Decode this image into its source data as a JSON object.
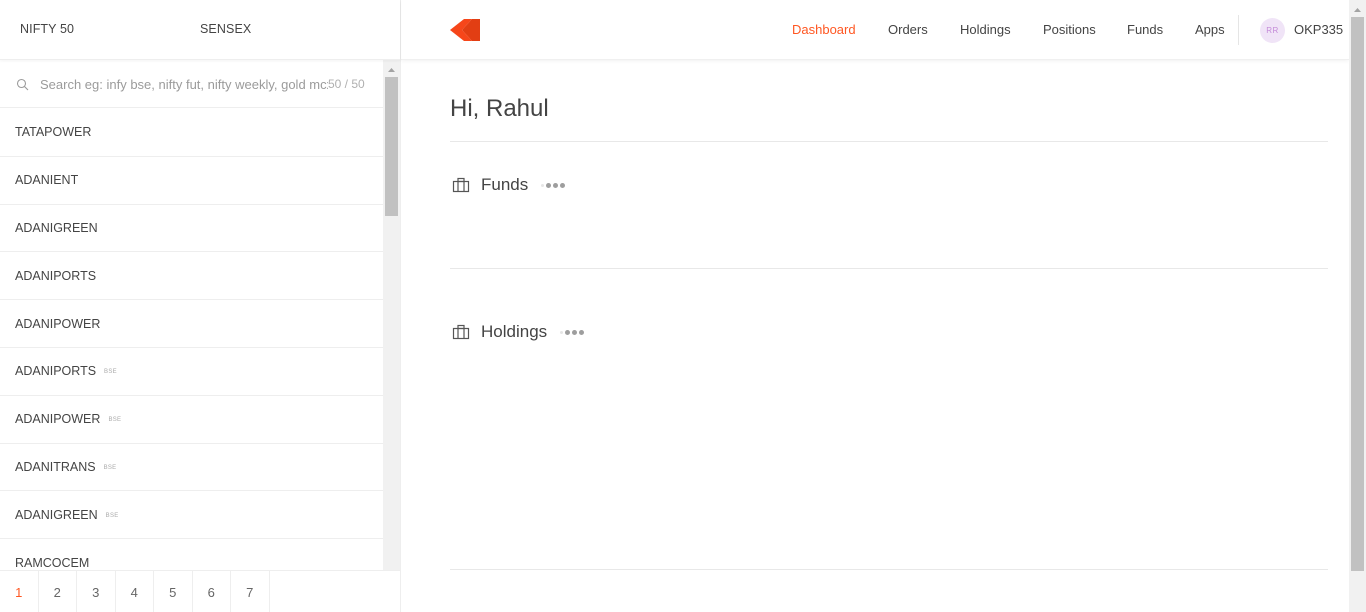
{
  "market": {
    "index1": "NIFTY 50",
    "index2": "SENSEX"
  },
  "search": {
    "placeholder": "Search eg: infy bse, nifty fut, nifty weekly, gold mcx",
    "count": "50 / 50"
  },
  "watchlist": [
    {
      "symbol": "TATAPOWER",
      "exchange": ""
    },
    {
      "symbol": "ADANIENT",
      "exchange": ""
    },
    {
      "symbol": "ADANIGREEN",
      "exchange": ""
    },
    {
      "symbol": "ADANIPORTS",
      "exchange": ""
    },
    {
      "symbol": "ADANIPOWER",
      "exchange": ""
    },
    {
      "symbol": "ADANIPORTS",
      "exchange": "BSE"
    },
    {
      "symbol": "ADANIPOWER",
      "exchange": "BSE"
    },
    {
      "symbol": "ADANITRANS",
      "exchange": "BSE"
    },
    {
      "symbol": "ADANIGREEN",
      "exchange": "BSE"
    },
    {
      "symbol": "RAMCOCEM",
      "exchange": ""
    }
  ],
  "pager": {
    "pages": [
      "1",
      "2",
      "3",
      "4",
      "5",
      "6",
      "7"
    ],
    "active": "1"
  },
  "nav": {
    "links": [
      "Dashboard",
      "Orders",
      "Holdings",
      "Positions",
      "Funds",
      "Apps"
    ],
    "active": "Dashboard",
    "avatar_initials": "RR",
    "user_id": "OKP335"
  },
  "main": {
    "greeting": "Hi, Rahul",
    "sections": [
      "Funds",
      "Holdings"
    ]
  },
  "colors": {
    "accent": "#ff5722",
    "text": "#444444",
    "border": "#eeeeee"
  },
  "icons": {
    "search": "search-icon",
    "settings": "gear-icon",
    "logo": "kite-logo",
    "section": "briefcase-icon",
    "loading": "loading-dots-icon"
  }
}
